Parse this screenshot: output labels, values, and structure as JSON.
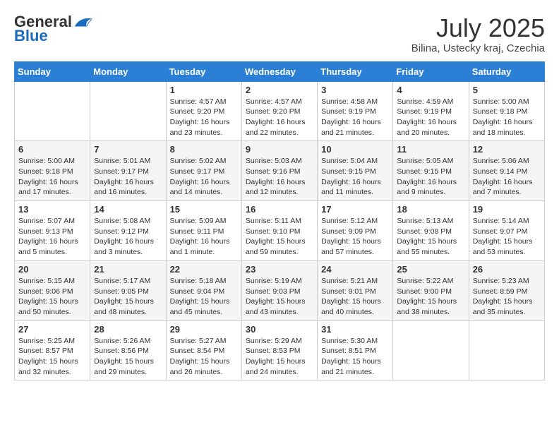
{
  "header": {
    "logo_general": "General",
    "logo_blue": "Blue",
    "month_title": "July 2025",
    "location": "Bilina, Ustecky kraj, Czechia"
  },
  "weekdays": [
    "Sunday",
    "Monday",
    "Tuesday",
    "Wednesday",
    "Thursday",
    "Friday",
    "Saturday"
  ],
  "weeks": [
    [
      {
        "day": "",
        "info": ""
      },
      {
        "day": "",
        "info": ""
      },
      {
        "day": "1",
        "info": "Sunrise: 4:57 AM\nSunset: 9:20 PM\nDaylight: 16 hours and 23 minutes."
      },
      {
        "day": "2",
        "info": "Sunrise: 4:57 AM\nSunset: 9:20 PM\nDaylight: 16 hours and 22 minutes."
      },
      {
        "day": "3",
        "info": "Sunrise: 4:58 AM\nSunset: 9:19 PM\nDaylight: 16 hours and 21 minutes."
      },
      {
        "day": "4",
        "info": "Sunrise: 4:59 AM\nSunset: 9:19 PM\nDaylight: 16 hours and 20 minutes."
      },
      {
        "day": "5",
        "info": "Sunrise: 5:00 AM\nSunset: 9:18 PM\nDaylight: 16 hours and 18 minutes."
      }
    ],
    [
      {
        "day": "6",
        "info": "Sunrise: 5:00 AM\nSunset: 9:18 PM\nDaylight: 16 hours and 17 minutes."
      },
      {
        "day": "7",
        "info": "Sunrise: 5:01 AM\nSunset: 9:17 PM\nDaylight: 16 hours and 16 minutes."
      },
      {
        "day": "8",
        "info": "Sunrise: 5:02 AM\nSunset: 9:17 PM\nDaylight: 16 hours and 14 minutes."
      },
      {
        "day": "9",
        "info": "Sunrise: 5:03 AM\nSunset: 9:16 PM\nDaylight: 16 hours and 12 minutes."
      },
      {
        "day": "10",
        "info": "Sunrise: 5:04 AM\nSunset: 9:15 PM\nDaylight: 16 hours and 11 minutes."
      },
      {
        "day": "11",
        "info": "Sunrise: 5:05 AM\nSunset: 9:15 PM\nDaylight: 16 hours and 9 minutes."
      },
      {
        "day": "12",
        "info": "Sunrise: 5:06 AM\nSunset: 9:14 PM\nDaylight: 16 hours and 7 minutes."
      }
    ],
    [
      {
        "day": "13",
        "info": "Sunrise: 5:07 AM\nSunset: 9:13 PM\nDaylight: 16 hours and 5 minutes."
      },
      {
        "day": "14",
        "info": "Sunrise: 5:08 AM\nSunset: 9:12 PM\nDaylight: 16 hours and 3 minutes."
      },
      {
        "day": "15",
        "info": "Sunrise: 5:09 AM\nSunset: 9:11 PM\nDaylight: 16 hours and 1 minute."
      },
      {
        "day": "16",
        "info": "Sunrise: 5:11 AM\nSunset: 9:10 PM\nDaylight: 15 hours and 59 minutes."
      },
      {
        "day": "17",
        "info": "Sunrise: 5:12 AM\nSunset: 9:09 PM\nDaylight: 15 hours and 57 minutes."
      },
      {
        "day": "18",
        "info": "Sunrise: 5:13 AM\nSunset: 9:08 PM\nDaylight: 15 hours and 55 minutes."
      },
      {
        "day": "19",
        "info": "Sunrise: 5:14 AM\nSunset: 9:07 PM\nDaylight: 15 hours and 53 minutes."
      }
    ],
    [
      {
        "day": "20",
        "info": "Sunrise: 5:15 AM\nSunset: 9:06 PM\nDaylight: 15 hours and 50 minutes."
      },
      {
        "day": "21",
        "info": "Sunrise: 5:17 AM\nSunset: 9:05 PM\nDaylight: 15 hours and 48 minutes."
      },
      {
        "day": "22",
        "info": "Sunrise: 5:18 AM\nSunset: 9:04 PM\nDaylight: 15 hours and 45 minutes."
      },
      {
        "day": "23",
        "info": "Sunrise: 5:19 AM\nSunset: 9:03 PM\nDaylight: 15 hours and 43 minutes."
      },
      {
        "day": "24",
        "info": "Sunrise: 5:21 AM\nSunset: 9:01 PM\nDaylight: 15 hours and 40 minutes."
      },
      {
        "day": "25",
        "info": "Sunrise: 5:22 AM\nSunset: 9:00 PM\nDaylight: 15 hours and 38 minutes."
      },
      {
        "day": "26",
        "info": "Sunrise: 5:23 AM\nSunset: 8:59 PM\nDaylight: 15 hours and 35 minutes."
      }
    ],
    [
      {
        "day": "27",
        "info": "Sunrise: 5:25 AM\nSunset: 8:57 PM\nDaylight: 15 hours and 32 minutes."
      },
      {
        "day": "28",
        "info": "Sunrise: 5:26 AM\nSunset: 8:56 PM\nDaylight: 15 hours and 29 minutes."
      },
      {
        "day": "29",
        "info": "Sunrise: 5:27 AM\nSunset: 8:54 PM\nDaylight: 15 hours and 26 minutes."
      },
      {
        "day": "30",
        "info": "Sunrise: 5:29 AM\nSunset: 8:53 PM\nDaylight: 15 hours and 24 minutes."
      },
      {
        "day": "31",
        "info": "Sunrise: 5:30 AM\nSunset: 8:51 PM\nDaylight: 15 hours and 21 minutes."
      },
      {
        "day": "",
        "info": ""
      },
      {
        "day": "",
        "info": ""
      }
    ]
  ]
}
